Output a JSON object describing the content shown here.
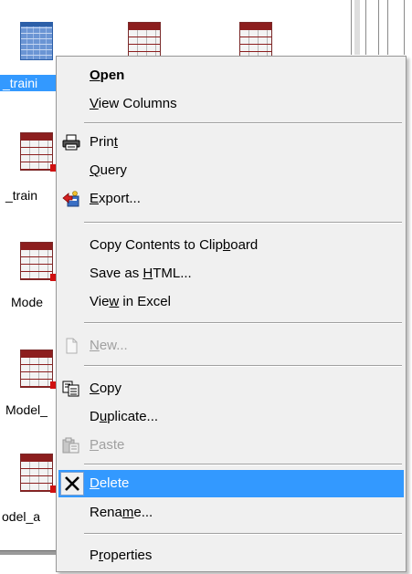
{
  "background": {
    "labels": [
      "_traini",
      "_train",
      "Mode",
      "Model_",
      "odel_a"
    ]
  },
  "menu": {
    "items": [
      {
        "pre": "",
        "ul": "O",
        "post": "pen",
        "icon": "",
        "state": "bold"
      },
      {
        "pre": "",
        "ul": "V",
        "post": "iew Columns",
        "icon": "",
        "state": "normal"
      },
      {
        "pre": "Prin",
        "ul": "t",
        "post": "",
        "icon": "print-icon",
        "state": "normal"
      },
      {
        "pre": "",
        "ul": "Q",
        "post": "uery",
        "icon": "",
        "state": "normal"
      },
      {
        "pre": "",
        "ul": "E",
        "post": "xport...",
        "icon": "export-icon",
        "state": "normal"
      },
      {
        "pre": "Copy Contents to Clip",
        "ul": "b",
        "post": "oard",
        "icon": "",
        "state": "normal"
      },
      {
        "pre": "Save as ",
        "ul": "H",
        "post": "TML...",
        "icon": "",
        "state": "normal"
      },
      {
        "pre": "Vie",
        "ul": "w",
        "post": " in Excel",
        "icon": "",
        "state": "normal"
      },
      {
        "pre": "",
        "ul": "N",
        "post": "ew...",
        "icon": "new-icon",
        "state": "disabled"
      },
      {
        "pre": "",
        "ul": "C",
        "post": "opy",
        "icon": "copy-icon",
        "state": "normal"
      },
      {
        "pre": "D",
        "ul": "u",
        "post": "plicate...",
        "icon": "",
        "state": "normal"
      },
      {
        "pre": "",
        "ul": "P",
        "post": "aste",
        "icon": "paste-icon",
        "state": "disabled"
      },
      {
        "pre": "",
        "ul": "D",
        "post": "elete",
        "icon": "delete-icon",
        "state": "highlighted"
      },
      {
        "pre": "Rena",
        "ul": "m",
        "post": "e...",
        "icon": "",
        "state": "normal"
      },
      {
        "pre": "P",
        "ul": "r",
        "post": "operties",
        "icon": "",
        "state": "normal"
      }
    ]
  }
}
